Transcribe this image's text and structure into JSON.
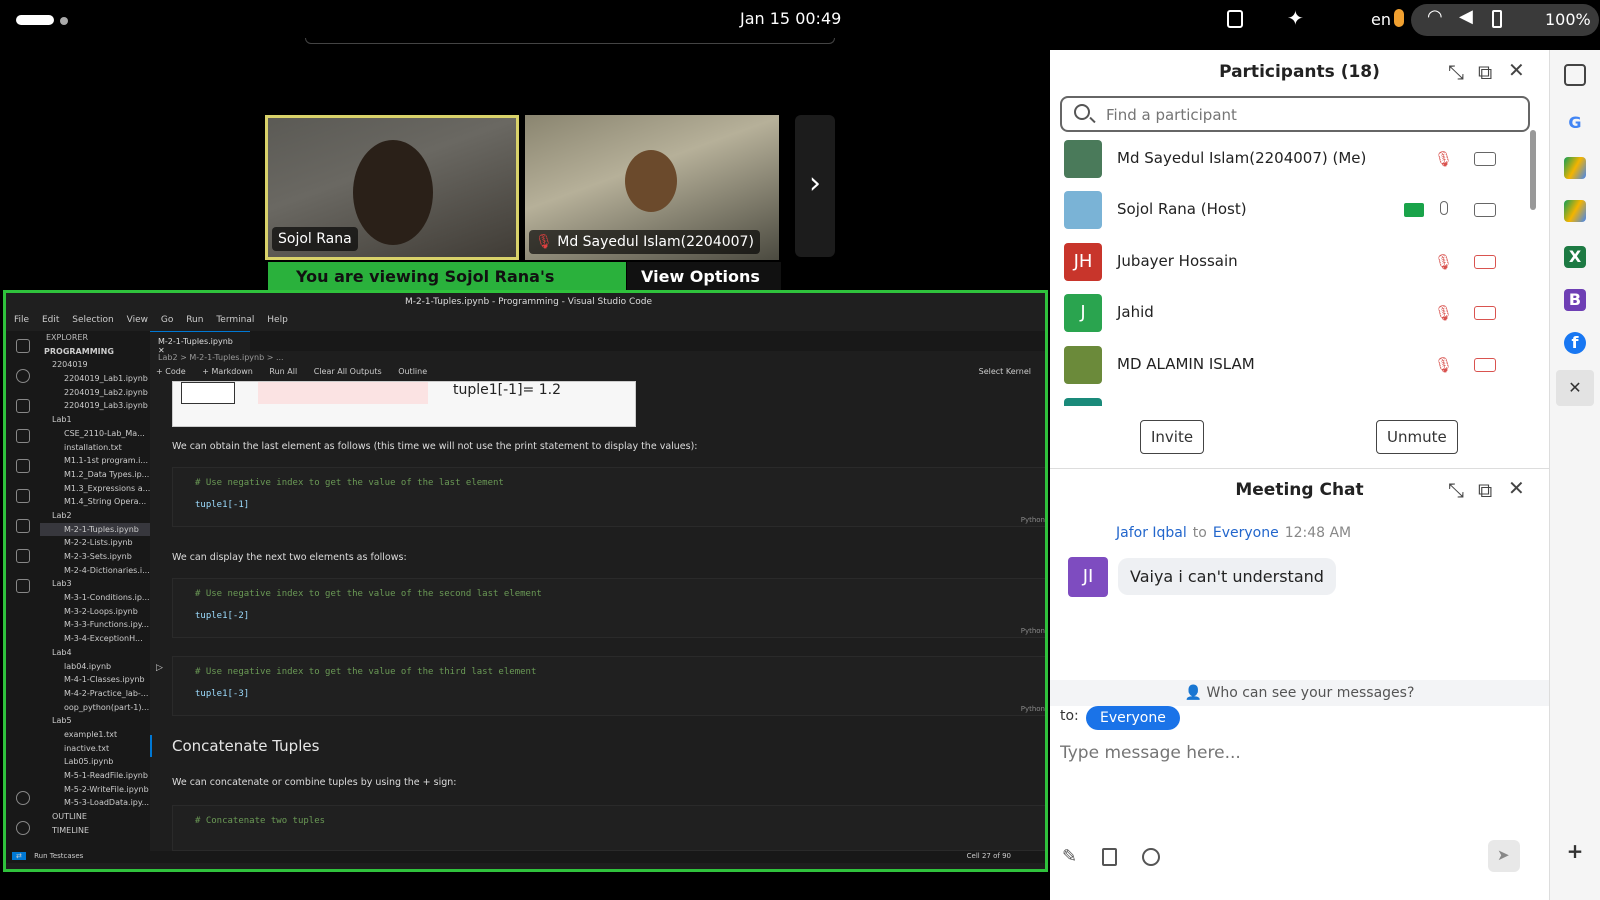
{
  "topbar": {
    "clock": "Jan 15  00:49",
    "language": "en",
    "battery": "100%"
  },
  "meeting": {
    "tiles": [
      {
        "name": "Sojol Rana"
      },
      {
        "name": "Md Sayedul Islam(2204007)"
      }
    ],
    "viewing_prefix": "You are viewing ",
    "viewing_name": "Sojol Rana's screen",
    "view_options": "View Options"
  },
  "vscode": {
    "title": "M-2-1-Tuples.ipynb - Programming - Visual Studio Code",
    "menu": [
      "File",
      "Edit",
      "Selection",
      "View",
      "Go",
      "Run",
      "Terminal",
      "Help"
    ],
    "explorer_label": "EXPLORER",
    "root": "PROGRAMMING",
    "files": [
      "2204019",
      "2204019_Lab1.ipynb",
      "2204019_Lab2.ipynb",
      "2204019_Lab3.ipynb",
      "Lab1",
      "CSE_2110-Lab_Ma...",
      "installation.txt",
      "M1.1-1st program.i...",
      "M1.2_Data Types.ip...",
      "M1.3_Expressions a...",
      "M1.4_String Opera...",
      "Lab2",
      "M-2-1-Tuples.ipynb",
      "M-2-2-Lists.ipynb",
      "M-2-3-Sets.ipynb",
      "M-2-4-Dictionaries.i...",
      "Lab3",
      "M-3-1-Conditions.ip...",
      "M-3-2-Loops.ipynb",
      "M-3-3-Functions.ipy...",
      "M-3-4-ExceptionH...",
      "Lab4",
      "lab04.ipynb",
      "M-4-1-Classes.ipynb",
      "M-4-2-Practice_lab-...",
      "oop_python(part-1)...",
      "Lab5",
      "example1.txt",
      "inactive.txt",
      "Lab05.ipynb",
      "M-5-1-ReadFile.ipynb",
      "M-5-2-WriteFile.ipynb",
      "M-5-3-LoadData.ipy...",
      "OUTLINE",
      "TIMELINE"
    ],
    "tab": "M-2-1-Tuples.ipynb",
    "breadcrumb": "Lab2 > M-2-1-Tuples.ipynb > ...",
    "toolbar": [
      "+ Code",
      "+ Markdown",
      "Run All",
      "Clear All Outputs",
      "Outline"
    ],
    "select_kernel": "Select Kernel",
    "image_text": "tuple1[-1]= 1.2",
    "text1": "We can obtain the last element as follows (this time we will not use the print statement to display the values):",
    "cell1_comment": "# Use negative index to get the value of the last element",
    "cell1_code": "tuple1[-1]",
    "text2": "We can display the next two elements as follows:",
    "cell2_comment": "# Use negative index to get the value of the second last element",
    "cell2_code": "tuple1[-2]",
    "cell3_comment": "# Use negative index to get the value of the third last element",
    "cell3_code": "tuple1[-3]",
    "lang": "Python",
    "heading": "Concatenate Tuples",
    "text3": "We can concatenate or combine tuples by using the + sign:",
    "cell4_comment": "# Concatenate two tuples",
    "status_left": "Run Testcases",
    "status_right": "Cell 27 of 90"
  },
  "participants": {
    "title": "Participants (18)",
    "search_placeholder": "Find a participant",
    "list": [
      {
        "name": "Md Sayedul Islam(2204007) (Me)",
        "initials": "",
        "color": "#4a7a5a"
      },
      {
        "name": "Sojol Rana (Host)",
        "initials": "",
        "color": "#7ab3d6"
      },
      {
        "name": "Jubayer Hossain",
        "initials": "JH",
        "color": "#c8352b"
      },
      {
        "name": "Jahid",
        "initials": "J",
        "color": "#2aa44f"
      },
      {
        "name": "MD ALAMIN ISLAM",
        "initials": "",
        "color": "#6b8a3a"
      }
    ],
    "invite": "Invite",
    "unmute": "Unmute"
  },
  "chat": {
    "title": "Meeting Chat",
    "sender": "Jafor Iqbal",
    "to_word": "to",
    "recipient": "Everyone",
    "time": "12:48 AM",
    "avatar": "JI",
    "message": "Vaiya i can't understand",
    "who_can_see": "Who can see your messages?",
    "to_label": "to:",
    "to_target": "Everyone",
    "input_placeholder": "Type message here..."
  }
}
